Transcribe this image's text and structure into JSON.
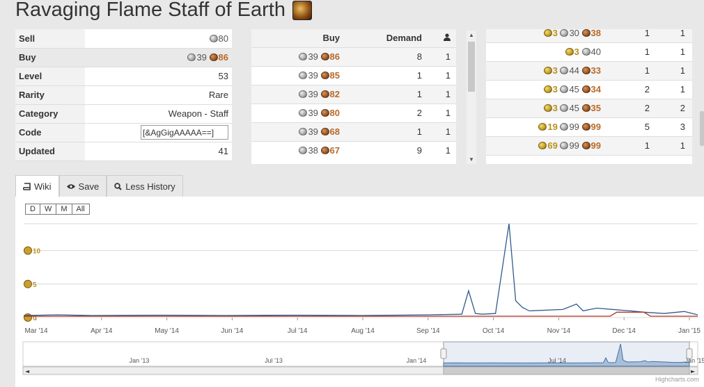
{
  "title": "Ravaging Flame Staff of Earth",
  "info": [
    {
      "label": "Sell",
      "coins": [
        {
          "type": "silver",
          "value": "80"
        }
      ]
    },
    {
      "label": "Buy",
      "coins": [
        {
          "type": "silver",
          "value": "39"
        },
        {
          "type": "copper",
          "value": "86"
        }
      ]
    },
    {
      "label": "Level",
      "text": "53"
    },
    {
      "label": "Rarity",
      "text": "Rare"
    },
    {
      "label": "Category",
      "text": "Weapon - Staff"
    },
    {
      "label": "Code",
      "input": "[&AgGigAAAAA==]"
    },
    {
      "label": "Updated",
      "text": "41"
    }
  ],
  "buy_table": {
    "headers": {
      "buy": "Buy",
      "demand": "Demand"
    },
    "rows": [
      {
        "silver": "39",
        "copper": "86",
        "demand": "8",
        "count": "1"
      },
      {
        "silver": "39",
        "copper": "85",
        "demand": "1",
        "count": "1"
      },
      {
        "silver": "39",
        "copper": "82",
        "demand": "1",
        "count": "1"
      },
      {
        "silver": "39",
        "copper": "80",
        "demand": "2",
        "count": "1"
      },
      {
        "silver": "39",
        "copper": "68",
        "demand": "1",
        "count": "1"
      },
      {
        "silver": "38",
        "copper": "67",
        "demand": "9",
        "count": "1"
      }
    ]
  },
  "sell_table": {
    "rows": [
      {
        "gold": "3",
        "silver": "30",
        "copper": "38",
        "supply": "1",
        "count": "1"
      },
      {
        "gold": "3",
        "silver": "40",
        "copper": "",
        "supply": "1",
        "count": "1"
      },
      {
        "gold": "3",
        "silver": "44",
        "copper": "33",
        "supply": "1",
        "count": "1"
      },
      {
        "gold": "3",
        "silver": "45",
        "copper": "34",
        "supply": "2",
        "count": "1"
      },
      {
        "gold": "3",
        "silver": "45",
        "copper": "35",
        "supply": "2",
        "count": "2"
      },
      {
        "gold": "19",
        "silver": "99",
        "copper": "99",
        "supply": "5",
        "count": "3"
      },
      {
        "gold": "69",
        "silver": "99",
        "copper": "99",
        "supply": "1",
        "count": "1"
      }
    ]
  },
  "tabs": {
    "wiki": "Wiki",
    "save": "Save",
    "history": "Less History"
  },
  "zoom_buttons": [
    "D",
    "W",
    "M",
    "All"
  ],
  "credit": "Highcharts.com",
  "chart_data": {
    "type": "line",
    "y_axis_labels": [
      "10",
      "5",
      "0"
    ],
    "y_axis_unit": "gold",
    "ylim": [
      0,
      14
    ],
    "x_tick_labels": [
      "Mar '14",
      "Apr '14",
      "May '14",
      "Jun '14",
      "Jul '14",
      "Aug '14",
      "Sep '14",
      "Oct '14",
      "Nov '14",
      "Dec '14",
      "Jan '15"
    ],
    "navigator_tick_labels": [
      "Jan '13",
      "Jul '13",
      "Jan '14",
      "Jul '14",
      "Jan '15"
    ],
    "series": [
      {
        "color": "#2f5b8a",
        "x": [
          0,
          0.05,
          0.1,
          0.2,
          0.3,
          0.4,
          0.5,
          0.6,
          0.65,
          0.66,
          0.67,
          0.68,
          0.7,
          0.72,
          0.73,
          0.74,
          0.75,
          0.8,
          0.82,
          0.83,
          0.85,
          0.9,
          0.92,
          0.95,
          0.98,
          1.0
        ],
        "y": [
          0.3,
          0.4,
          0.3,
          0.35,
          0.3,
          0.35,
          0.3,
          0.4,
          0.5,
          4.0,
          0.6,
          0.5,
          0.6,
          14,
          2.5,
          1.5,
          1.0,
          1.2,
          2.0,
          1.0,
          1.4,
          1.0,
          0.8,
          0.6,
          0.9,
          0.4
        ]
      },
      {
        "color": "#b03020",
        "x": [
          0,
          0.5,
          0.6,
          0.7,
          0.8,
          0.87,
          0.88,
          0.92,
          0.93,
          1.0
        ],
        "y": [
          0.2,
          0.2,
          0.2,
          0.2,
          0.2,
          0.2,
          0.8,
          0.8,
          0.2,
          0.2
        ]
      }
    ]
  }
}
